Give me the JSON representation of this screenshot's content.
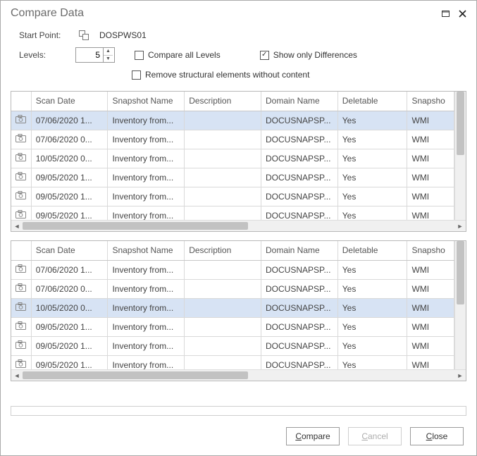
{
  "title": "Compare Data",
  "startPoint": {
    "label": "Start Point:",
    "value": "DOSPWS01"
  },
  "levels": {
    "label": "Levels:",
    "value": "5"
  },
  "checkboxes": {
    "compareAll": {
      "label": "Compare all Levels",
      "checked": false
    },
    "showDiff": {
      "label": "Show only Differences",
      "checked": true
    },
    "removeStructural": {
      "label": "Remove structural elements without content",
      "checked": false
    }
  },
  "columns": {
    "scanDate": "Scan Date",
    "snapshotName": "Snapshot Name",
    "description": "Description",
    "domainName": "Domain Name",
    "deletable": "Deletable",
    "snapshotType": "Snapsho"
  },
  "gridTop": {
    "selectedIndex": 0,
    "vThumbTop": 0,
    "vThumbHeight": 90,
    "hThumbWidth": 320,
    "rows": [
      {
        "scan": "07/06/2020 1...",
        "snap": "Inventory from...",
        "desc": "",
        "dom": "DOCUSNAPSP...",
        "del": "Yes",
        "type": "WMI"
      },
      {
        "scan": "07/06/2020 0...",
        "snap": "Inventory from...",
        "desc": "",
        "dom": "DOCUSNAPSP...",
        "del": "Yes",
        "type": "WMI"
      },
      {
        "scan": "10/05/2020 0...",
        "snap": "Inventory from...",
        "desc": "",
        "dom": "DOCUSNAPSP...",
        "del": "Yes",
        "type": "WMI"
      },
      {
        "scan": "09/05/2020 1...",
        "snap": "Inventory from...",
        "desc": "",
        "dom": "DOCUSNAPSP...",
        "del": "Yes",
        "type": "WMI"
      },
      {
        "scan": "09/05/2020 1...",
        "snap": "Inventory from...",
        "desc": "",
        "dom": "DOCUSNAPSP...",
        "del": "Yes",
        "type": "WMI"
      },
      {
        "scan": "09/05/2020 1...",
        "snap": "Inventory from...",
        "desc": "",
        "dom": "DOCUSNAPSP...",
        "del": "Yes",
        "type": "WMI"
      }
    ]
  },
  "gridBottom": {
    "selectedIndex": 2,
    "vThumbTop": 0,
    "vThumbHeight": 90,
    "hThumbWidth": 320,
    "rows": [
      {
        "scan": "07/06/2020 1...",
        "snap": "Inventory from...",
        "desc": "",
        "dom": "DOCUSNAPSP...",
        "del": "Yes",
        "type": "WMI"
      },
      {
        "scan": "07/06/2020 0...",
        "snap": "Inventory from...",
        "desc": "",
        "dom": "DOCUSNAPSP...",
        "del": "Yes",
        "type": "WMI"
      },
      {
        "scan": "10/05/2020 0...",
        "snap": "Inventory from...",
        "desc": "",
        "dom": "DOCUSNAPSP...",
        "del": "Yes",
        "type": "WMI"
      },
      {
        "scan": "09/05/2020 1...",
        "snap": "Inventory from...",
        "desc": "",
        "dom": "DOCUSNAPSP...",
        "del": "Yes",
        "type": "WMI"
      },
      {
        "scan": "09/05/2020 1...",
        "snap": "Inventory from...",
        "desc": "",
        "dom": "DOCUSNAPSP...",
        "del": "Yes",
        "type": "WMI"
      },
      {
        "scan": "09/05/2020 1...",
        "snap": "Inventory from...",
        "desc": "",
        "dom": "DOCUSNAPSP...",
        "del": "Yes",
        "type": "WMI"
      }
    ]
  },
  "buttons": {
    "compare": "Compare",
    "cancel": "Cancel",
    "close": "Close"
  }
}
